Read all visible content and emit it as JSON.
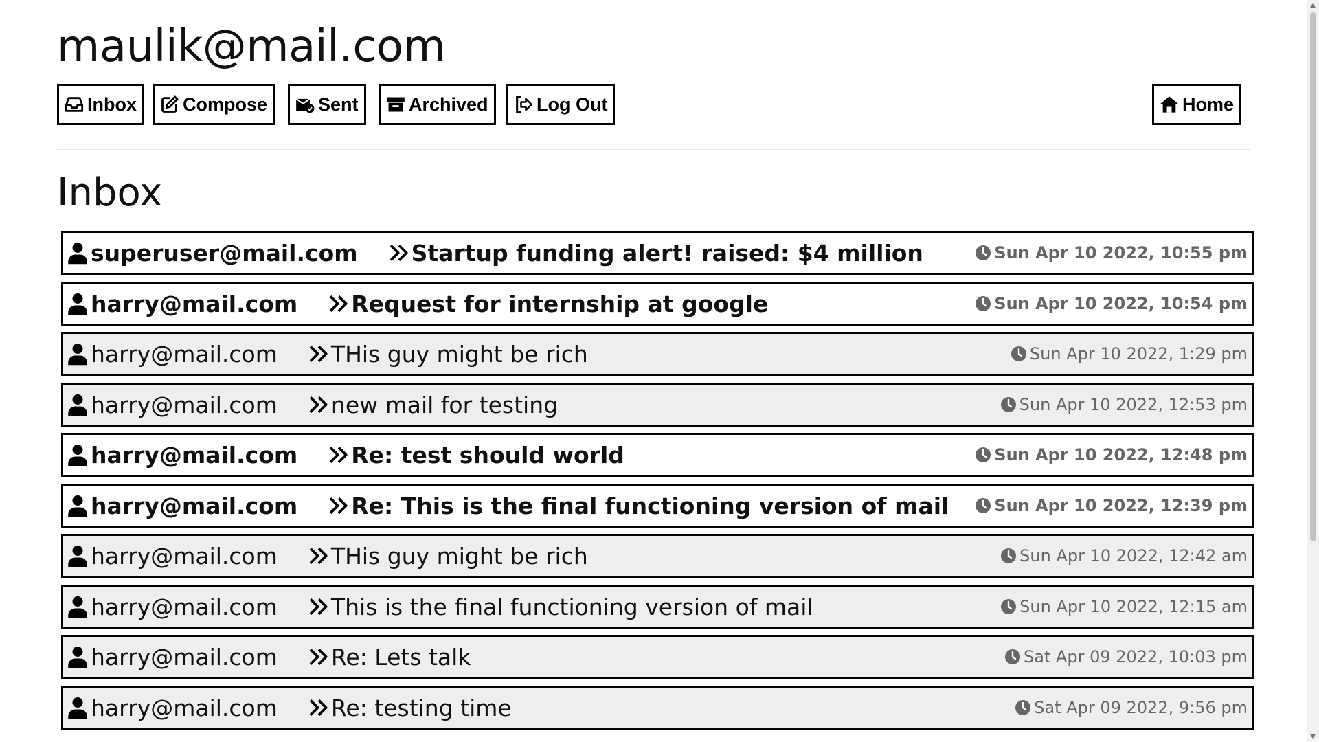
{
  "header": {
    "user_email": "maulik@mail.com"
  },
  "nav": {
    "inbox": "Inbox",
    "compose": "Compose",
    "sent": "Sent",
    "archived": "Archived",
    "logout": "Log Out",
    "home": "Home"
  },
  "main": {
    "title": "Inbox"
  },
  "emails": [
    {
      "sender": "superuser@mail.com",
      "subject": "Startup funding alert! raised: $4 million",
      "timestamp": "Sun Apr 10 2022, 10:55 pm",
      "read": false
    },
    {
      "sender": "harry@mail.com",
      "subject": "Request for internship at google",
      "timestamp": "Sun Apr 10 2022, 10:54 pm",
      "read": false
    },
    {
      "sender": "harry@mail.com",
      "subject": "THis guy might be rich",
      "timestamp": "Sun Apr 10 2022, 1:29 pm",
      "read": true
    },
    {
      "sender": "harry@mail.com",
      "subject": "new mail for testing",
      "timestamp": "Sun Apr 10 2022, 12:53 pm",
      "read": true
    },
    {
      "sender": "harry@mail.com",
      "subject": "Re: test should world",
      "timestamp": "Sun Apr 10 2022, 12:48 pm",
      "read": false
    },
    {
      "sender": "harry@mail.com",
      "subject": "Re: This is the final functioning version of mail",
      "timestamp": "Sun Apr 10 2022, 12:39 pm",
      "read": false
    },
    {
      "sender": "harry@mail.com",
      "subject": "THis guy might be rich",
      "timestamp": "Sun Apr 10 2022, 12:42 am",
      "read": true
    },
    {
      "sender": "harry@mail.com",
      "subject": "This is the final functioning version of mail",
      "timestamp": "Sun Apr 10 2022, 12:15 am",
      "read": true
    },
    {
      "sender": "harry@mail.com",
      "subject": "Re: Lets talk",
      "timestamp": "Sat Apr 09 2022, 10:03 pm",
      "read": true
    },
    {
      "sender": "harry@mail.com",
      "subject": "Re: testing time",
      "timestamp": "Sat Apr 09 2022, 9:56 pm",
      "read": true
    }
  ],
  "colors": {
    "border": "#000000",
    "read_row_bg": "#eeeeee",
    "unread_row_bg": "#ffffff",
    "timestamp": "#666666"
  },
  "icons": {
    "inbox": "inbox-icon",
    "compose": "edit-icon",
    "sent": "envelope-check-icon",
    "archived": "archive-icon",
    "logout": "sign-out-icon",
    "home": "home-icon",
    "sender": "user-icon",
    "subject": "double-chevron-right-icon",
    "time": "clock-icon"
  }
}
